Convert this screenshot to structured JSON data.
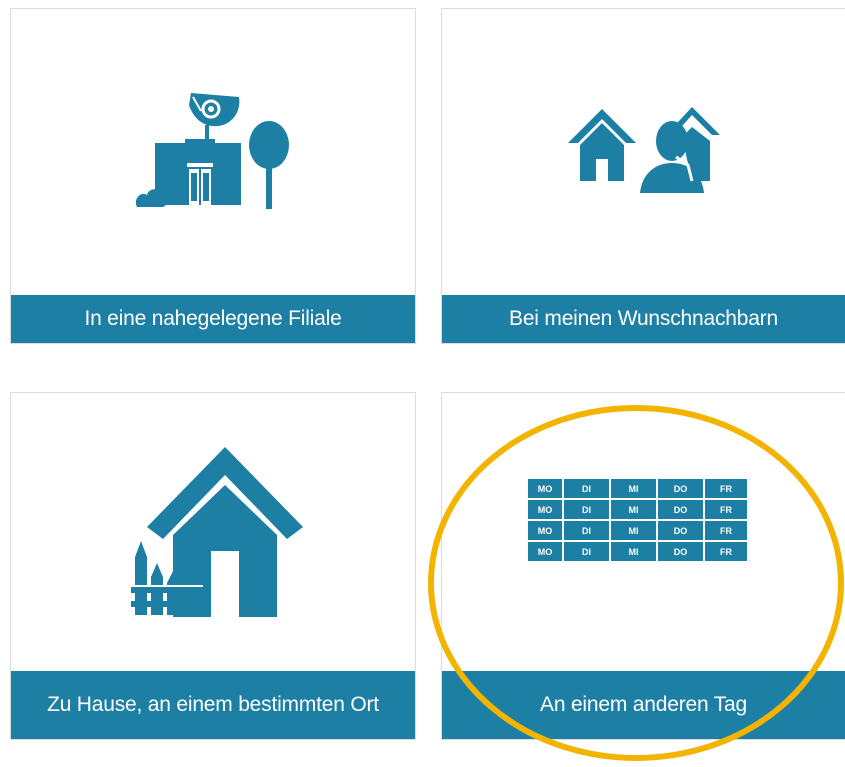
{
  "options": [
    {
      "label": "In eine nahegelegene Filiale",
      "icon": "post-office-icon"
    },
    {
      "label": "Bei meinen Wunschnachbarn",
      "icon": "neighbor-icon"
    },
    {
      "label": "Zu Hause, an einem bestimmten Ort",
      "icon": "house-icon"
    },
    {
      "label": "An einem anderen Tag",
      "icon": "calendar-icon"
    }
  ],
  "weekdays": [
    "MO",
    "DI",
    "MI",
    "DO",
    "FR"
  ],
  "colors": {
    "accent": "#1c7fa3",
    "highlight": "#f2b400",
    "border": "#d9dcde",
    "label_text": "#ffffff"
  }
}
